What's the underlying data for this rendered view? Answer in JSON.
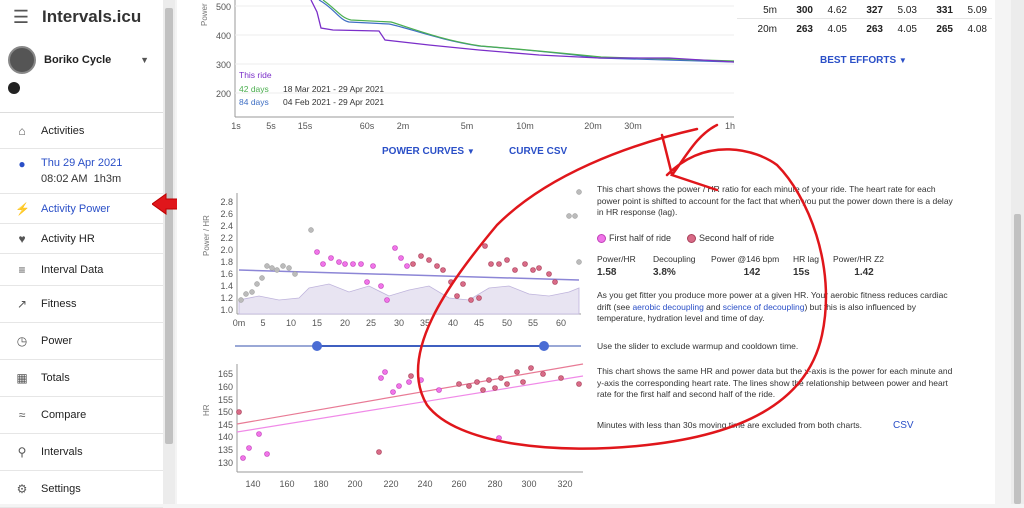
{
  "app": {
    "title": "Intervals.icu"
  },
  "athlete": {
    "name": "Boriko Cycle"
  },
  "sidebar": {
    "activities": "Activities",
    "ride_date": "Thu 29 Apr 2021",
    "ride_time": "08:02 AM",
    "ride_duration": "1h3m",
    "items": [
      "Activity Power",
      "Activity HR",
      "Interval Data",
      "Fitness",
      "Power",
      "Totals",
      "Compare",
      "Intervals",
      "Settings"
    ]
  },
  "icons": [
    "menu-icon",
    "home-icon",
    "bike-icon",
    "bolt-icon",
    "heart-icon",
    "list-icon",
    "trend-icon",
    "speed-icon",
    "calendar-icon",
    "compare-icon",
    "search-icon",
    "gear-icon"
  ],
  "accent": "#2a4fc7",
  "curve": {
    "y_axis": "Power",
    "y_ticks": [
      "500",
      "400",
      "300",
      "200"
    ],
    "x_ticks": [
      "1s",
      "5s",
      "15s",
      "60s",
      "2m",
      "5m",
      "10m",
      "20m",
      "30m",
      "1h"
    ],
    "legend": [
      {
        "label": "This ride",
        "range": "",
        "color": "#7b2fc9"
      },
      {
        "label": "42 days",
        "range": "18 Mar 2021 - 29 Apr 2021",
        "color": "#4caf50"
      },
      {
        "label": "84 days",
        "range": "04 Feb 2021 - 29 Apr 2021",
        "color": "#3f6fc4"
      }
    ],
    "power_curves_btn": "POWER CURVES",
    "csv_btn": "CURVE CSV"
  },
  "best_efforts": {
    "rows": [
      {
        "dur": "5m",
        "w1": "300",
        "k1": "4.62",
        "w2": "327",
        "k2": "5.03",
        "w3": "331",
        "k3": "5.09"
      },
      {
        "dur": "20m",
        "w1": "263",
        "k1": "4.05",
        "w2": "263",
        "k2": "4.05",
        "w3": "265",
        "k3": "4.08"
      }
    ],
    "btn": "BEST EFFORTS"
  },
  "power_hr_chart": {
    "y_label": "Power / HR",
    "y_ticks": [
      "2.8",
      "2.6",
      "2.4",
      "2.2",
      "2.0",
      "1.8",
      "1.6",
      "1.4",
      "1.2",
      "1.0"
    ],
    "x_ticks": [
      "0m",
      "5",
      "10",
      "15",
      "20",
      "25",
      "30",
      "35",
      "40",
      "45",
      "50",
      "55",
      "60"
    ]
  },
  "hr_chart": {
    "y_label": "HR",
    "y_ticks": [
      "165",
      "160",
      "155",
      "150",
      "145",
      "140",
      "135",
      "130"
    ],
    "x_ticks": [
      "140",
      "160",
      "180",
      "200",
      "220",
      "240",
      "260",
      "280",
      "300",
      "320"
    ]
  },
  "info": {
    "p1": "This chart shows the power / HR ratio for each minute of your ride. The heart rate for each power point is shifted to account for the fact that when you put the power down there is a delay in HR response (lag).",
    "legend_first": "First half of ride",
    "legend_second": "Second half of ride",
    "stats_labels": [
      "Power/HR",
      "Decoupling",
      "Power @146 bpm",
      "HR lag",
      "Power/HR Z2"
    ],
    "stats_values": [
      "1.58",
      "3.8%",
      "142",
      "15s",
      "1.42"
    ],
    "p2a": "As you get fitter you produce more power at a given HR. Your aerobic fitness reduces cardiac drift (see ",
    "p2link1": "aerobic decoupling",
    "p2b": " and ",
    "p2link2": "science of decoupling",
    "p2c": ") but this is also influenced by temperature, hydration level and time of day.",
    "p3": "Use the slider to exclude warmup and cooldown time.",
    "p4": "This chart shows the same HR and power data but the x-axis is the power for each minute and y-axis the corresponding heart rate. The lines show the relationship between power and heart rate for the first half and second half of the ride.",
    "p5": "Minutes with less than 30s moving time are excluded from both charts.",
    "csv": "CSV"
  }
}
